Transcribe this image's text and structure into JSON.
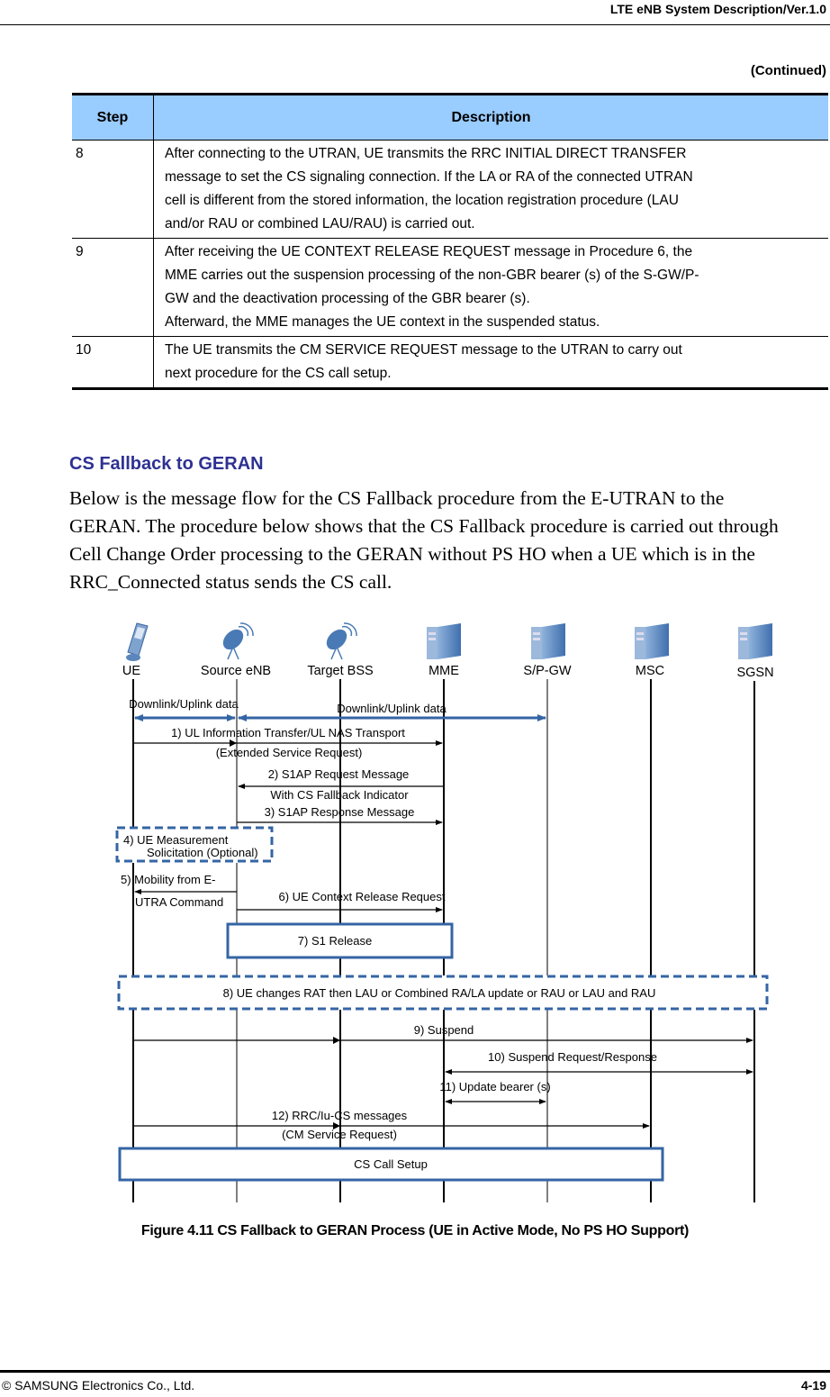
{
  "header": {
    "title": "LTE eNB System Description/Ver.1.0"
  },
  "continued_label": "(Continued)",
  "table": {
    "columns": [
      "Step",
      "Description"
    ],
    "rows": [
      {
        "step": "8",
        "lines": [
          "After connecting to the UTRAN, UE transmits the RRC INITIAL DIRECT TRANSFER",
          "message to set the CS signaling connection. If the LA or RA of the connected UTRAN",
          "cell is different from the stored information, the location registration procedure (LAU",
          "and/or RAU or combined LAU/RAU) is carried out."
        ]
      },
      {
        "step": "9",
        "lines": [
          "After receiving the UE CONTEXT RELEASE REQUEST message in Procedure 6, the",
          "MME carries out the suspension processing of the non-GBR bearer (s) of the S-GW/P-",
          "GW and the deactivation processing of the GBR bearer (s).",
          "Afterward, the MME manages the UE context in the suspended status."
        ]
      },
      {
        "step": "10",
        "lines": [
          "The UE transmits the CM SERVICE REQUEST message to the UTRAN to carry out",
          "next procedure for the CS call setup."
        ]
      }
    ]
  },
  "section": {
    "title": "CS Fallback to GERAN",
    "intro_lines": [
      "Below is the message flow for the CS Fallback procedure from the E-UTRAN to the",
      "GERAN. The procedure below shows that the CS Fallback procedure is carried out through",
      "Cell Change Order processing to the GERAN without PS HO when a UE which is in the",
      "RRC_Connected status sends the CS call."
    ]
  },
  "diagram": {
    "colors": {
      "accent": "#3465a4",
      "line": "#000000",
      "icon": "#4a7ab5"
    },
    "entities": [
      {
        "id": "ue",
        "label": "UE",
        "icon": "mobile-phone-icon"
      },
      {
        "id": "senb",
        "label": "Source eNB",
        "icon": "satellite-dish-icon"
      },
      {
        "id": "tbss",
        "label": "Target BSS",
        "icon": "satellite-dish-icon"
      },
      {
        "id": "mme",
        "label": "MME",
        "icon": "server-icon"
      },
      {
        "id": "spgw",
        "label": "S/P-GW",
        "icon": "server-icon"
      },
      {
        "id": "msc",
        "label": "MSC",
        "icon": "server-icon"
      },
      {
        "id": "sgsn",
        "label": "SGSN",
        "icon": "server-icon"
      }
    ],
    "data_label_1": "Downlink/Uplink data",
    "data_label_2": "Downlink/Uplink data",
    "messages": {
      "m1a": "1)    UL Information Transfer/UL NAS Transport",
      "m1b": "(Extended Service Request)",
      "m2a": "2)    S1AP Request Message",
      "m2b": "With CS Fallback Indicator",
      "m3": "3)    S1AP Response Message",
      "m4a": "4)    UE Measurement",
      "m4b": "Solicitation (Optional)",
      "m5a": "5)    Mobility from E-",
      "m5b": "UTRA Command",
      "m6": "6)    UE Context Release Request",
      "m7": "7)    S1 Release",
      "m8": "8)    UE changes RAT then LAU or Combined RA/LA update or RAU or LAU and RAU",
      "m9": "9)    Suspend",
      "m10": "10) Suspend Request/Response",
      "m11": "11) Update bearer (s)",
      "m12a": "12) RRC/Iu-CS messages",
      "m12b": "(CM Service Request)",
      "cs_call": "CS Call Setup"
    }
  },
  "caption": "Figure 4.11    CS Fallback to GERAN Process (UE in Active Mode, No PS HO Support)",
  "footer": {
    "copyright": "© SAMSUNG Electronics Co., Ltd.",
    "page": "4-19"
  }
}
